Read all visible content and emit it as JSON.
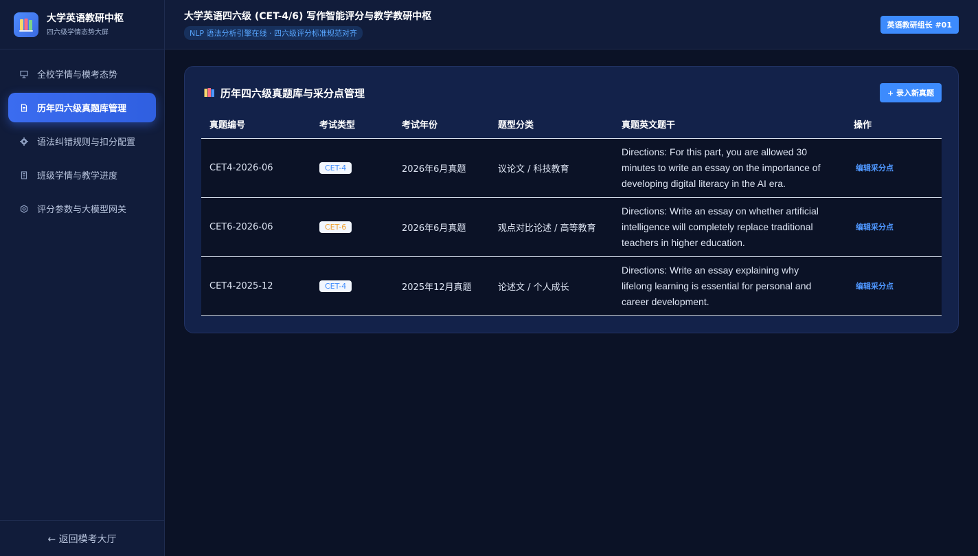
{
  "sidebar": {
    "brand_title": "大学英语教研中枢",
    "brand_subtitle": "四六级学情态势大屏",
    "items": [
      {
        "label": "全校学情与模考态势",
        "icon": "presentation-icon"
      },
      {
        "label": "历年四六级真题库管理",
        "icon": "document-icon"
      },
      {
        "label": "语法纠错规则与扣分配置",
        "icon": "gear-icon"
      },
      {
        "label": "班级学情与教学进度",
        "icon": "building-icon"
      },
      {
        "label": "评分参数与大模型网关",
        "icon": "settings-icon"
      }
    ],
    "active_index": 1,
    "footer": "← 返回模考大厅"
  },
  "header": {
    "title": "大学英语四六级 (CET-4/6) 写作智能评分与教学教研中枢",
    "status": "NLP 语法分析引擎在线 · 四六级评分标准规范对齐",
    "user": "英语教研组长 #01"
  },
  "card": {
    "title": "历年四六级真题库与采分点管理",
    "add_button": "+ 录入新真题",
    "columns": [
      "真题编号",
      "考试类型",
      "考试年份",
      "题型分类",
      "真题英文题干",
      "操作"
    ],
    "rows": [
      {
        "id": "CET4-2026-06",
        "type": "CET-4",
        "year": "2026年6月真题",
        "category": "议论文 / 科技教育",
        "stem": "Directions: For this part, you are allowed 30 minutes to write an essay on the importance of developing digital literacy in the AI era.",
        "action": "编辑采分点"
      },
      {
        "id": "CET6-2026-06",
        "type": "CET-6",
        "year": "2026年6月真题",
        "category": "观点对比论述 / 高等教育",
        "stem": "Directions: Write an essay on whether artificial intelligence will completely replace traditional teachers in higher education.",
        "action": "编辑采分点"
      },
      {
        "id": "CET4-2025-12",
        "type": "CET-4",
        "year": "2025年12月真题",
        "category": "论述文 / 个人成长",
        "stem": "Directions: Write an essay explaining why lifelong learning is essential for personal and career development.",
        "action": "编辑采分点"
      }
    ]
  },
  "colors": {
    "accent": "#3d8bfd",
    "cet4": "#3d8bfd",
    "cet6": "#f0a030"
  }
}
